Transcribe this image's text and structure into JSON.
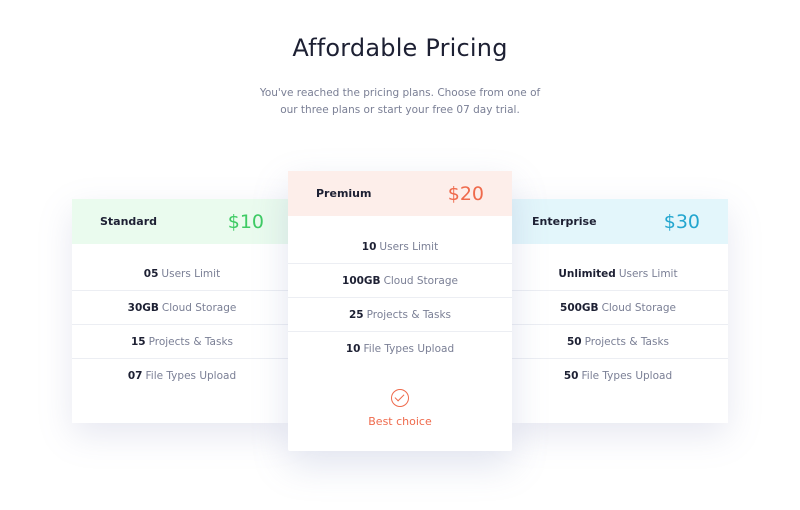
{
  "header": {
    "title": "Affordable Pricing",
    "subtitle": "You've reached the pricing plans. Choose from one of our three plans or start your free 07 day trial."
  },
  "colors": {
    "standard_bg": "#eafbee",
    "standard_price": "#3ecb64",
    "premium_bg": "#fdeeea",
    "premium_price": "#ef6a4c",
    "enterprise_bg": "#e3f6fb",
    "enterprise_price": "#23a6cf"
  },
  "plans": {
    "standard": {
      "name": "Standard",
      "price": "$10",
      "features": [
        {
          "value": "05",
          "label": "Users Limit"
        },
        {
          "value": "30GB",
          "label": "Cloud Storage"
        },
        {
          "value": "15",
          "label": "Projects & Tasks"
        },
        {
          "value": "07",
          "label": "File Types Upload"
        }
      ]
    },
    "premium": {
      "name": "Premium",
      "price": "$20",
      "features": [
        {
          "value": "10",
          "label": "Users Limit"
        },
        {
          "value": "100GB",
          "label": "Cloud Storage"
        },
        {
          "value": "25",
          "label": "Projects & Tasks"
        },
        {
          "value": "10",
          "label": "File Types Upload"
        }
      ],
      "badge": {
        "icon": "check-circle-icon",
        "label": "Best choice"
      }
    },
    "enterprise": {
      "name": "Enterprise",
      "price": "$30",
      "features": [
        {
          "value": "Unlimited",
          "label": "Users Limit"
        },
        {
          "value": "500GB",
          "label": "Cloud Storage"
        },
        {
          "value": "50",
          "label": "Projects & Tasks"
        },
        {
          "value": "50",
          "label": "File Types Upload"
        }
      ]
    }
  }
}
